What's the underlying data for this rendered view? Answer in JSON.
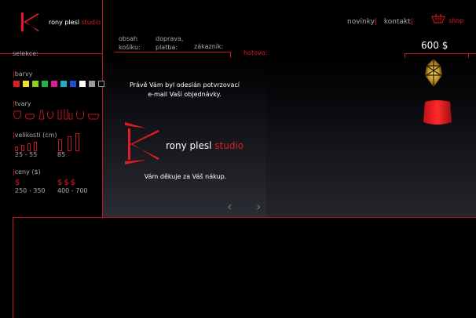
{
  "brand": {
    "name": "rony plesl",
    "studio": "studio"
  },
  "header": {
    "nav": [
      {
        "label": "novinky"
      },
      {
        "label": "kontakt"
      }
    ],
    "shop_label": "shop",
    "cart_total": "600 $"
  },
  "sidebar": {
    "selekce_label": "selekce:",
    "barvy_label": "barvy",
    "colors": [
      "#e01b22",
      "#f2e020",
      "#8ed11c",
      "#1fb44a",
      "#e01b95",
      "#1fb0c4",
      "#1d4fd6",
      "#ffffff",
      "#9a9a9a",
      "#000000"
    ],
    "tvary_label": "tvary",
    "velikosti_label": "velikosti (cm)",
    "size_ranges": [
      "25 - 55",
      "85"
    ],
    "ceny_label": "ceny ($)",
    "price_symbols": [
      "$",
      "$$$"
    ],
    "price_ranges": [
      "250 - 350",
      "400 - 700"
    ]
  },
  "steps": [
    {
      "label_line1": "obsah",
      "label_line2": "košíku:"
    },
    {
      "label_line1": "doprava,",
      "label_line2": "platba:"
    },
    {
      "label_line1": "",
      "label_line2": "zákazník:"
    },
    {
      "label_line1": "",
      "label_line2": "hotovo:"
    }
  ],
  "confirmation": {
    "line1": "Právě Vám byl odeslán potvrzovací",
    "line2": "e-mail Vaší objednávky.",
    "thanks": "Vám děkuje za Váš nákup."
  },
  "pager": {
    "prev": "‹",
    "next": "›"
  }
}
